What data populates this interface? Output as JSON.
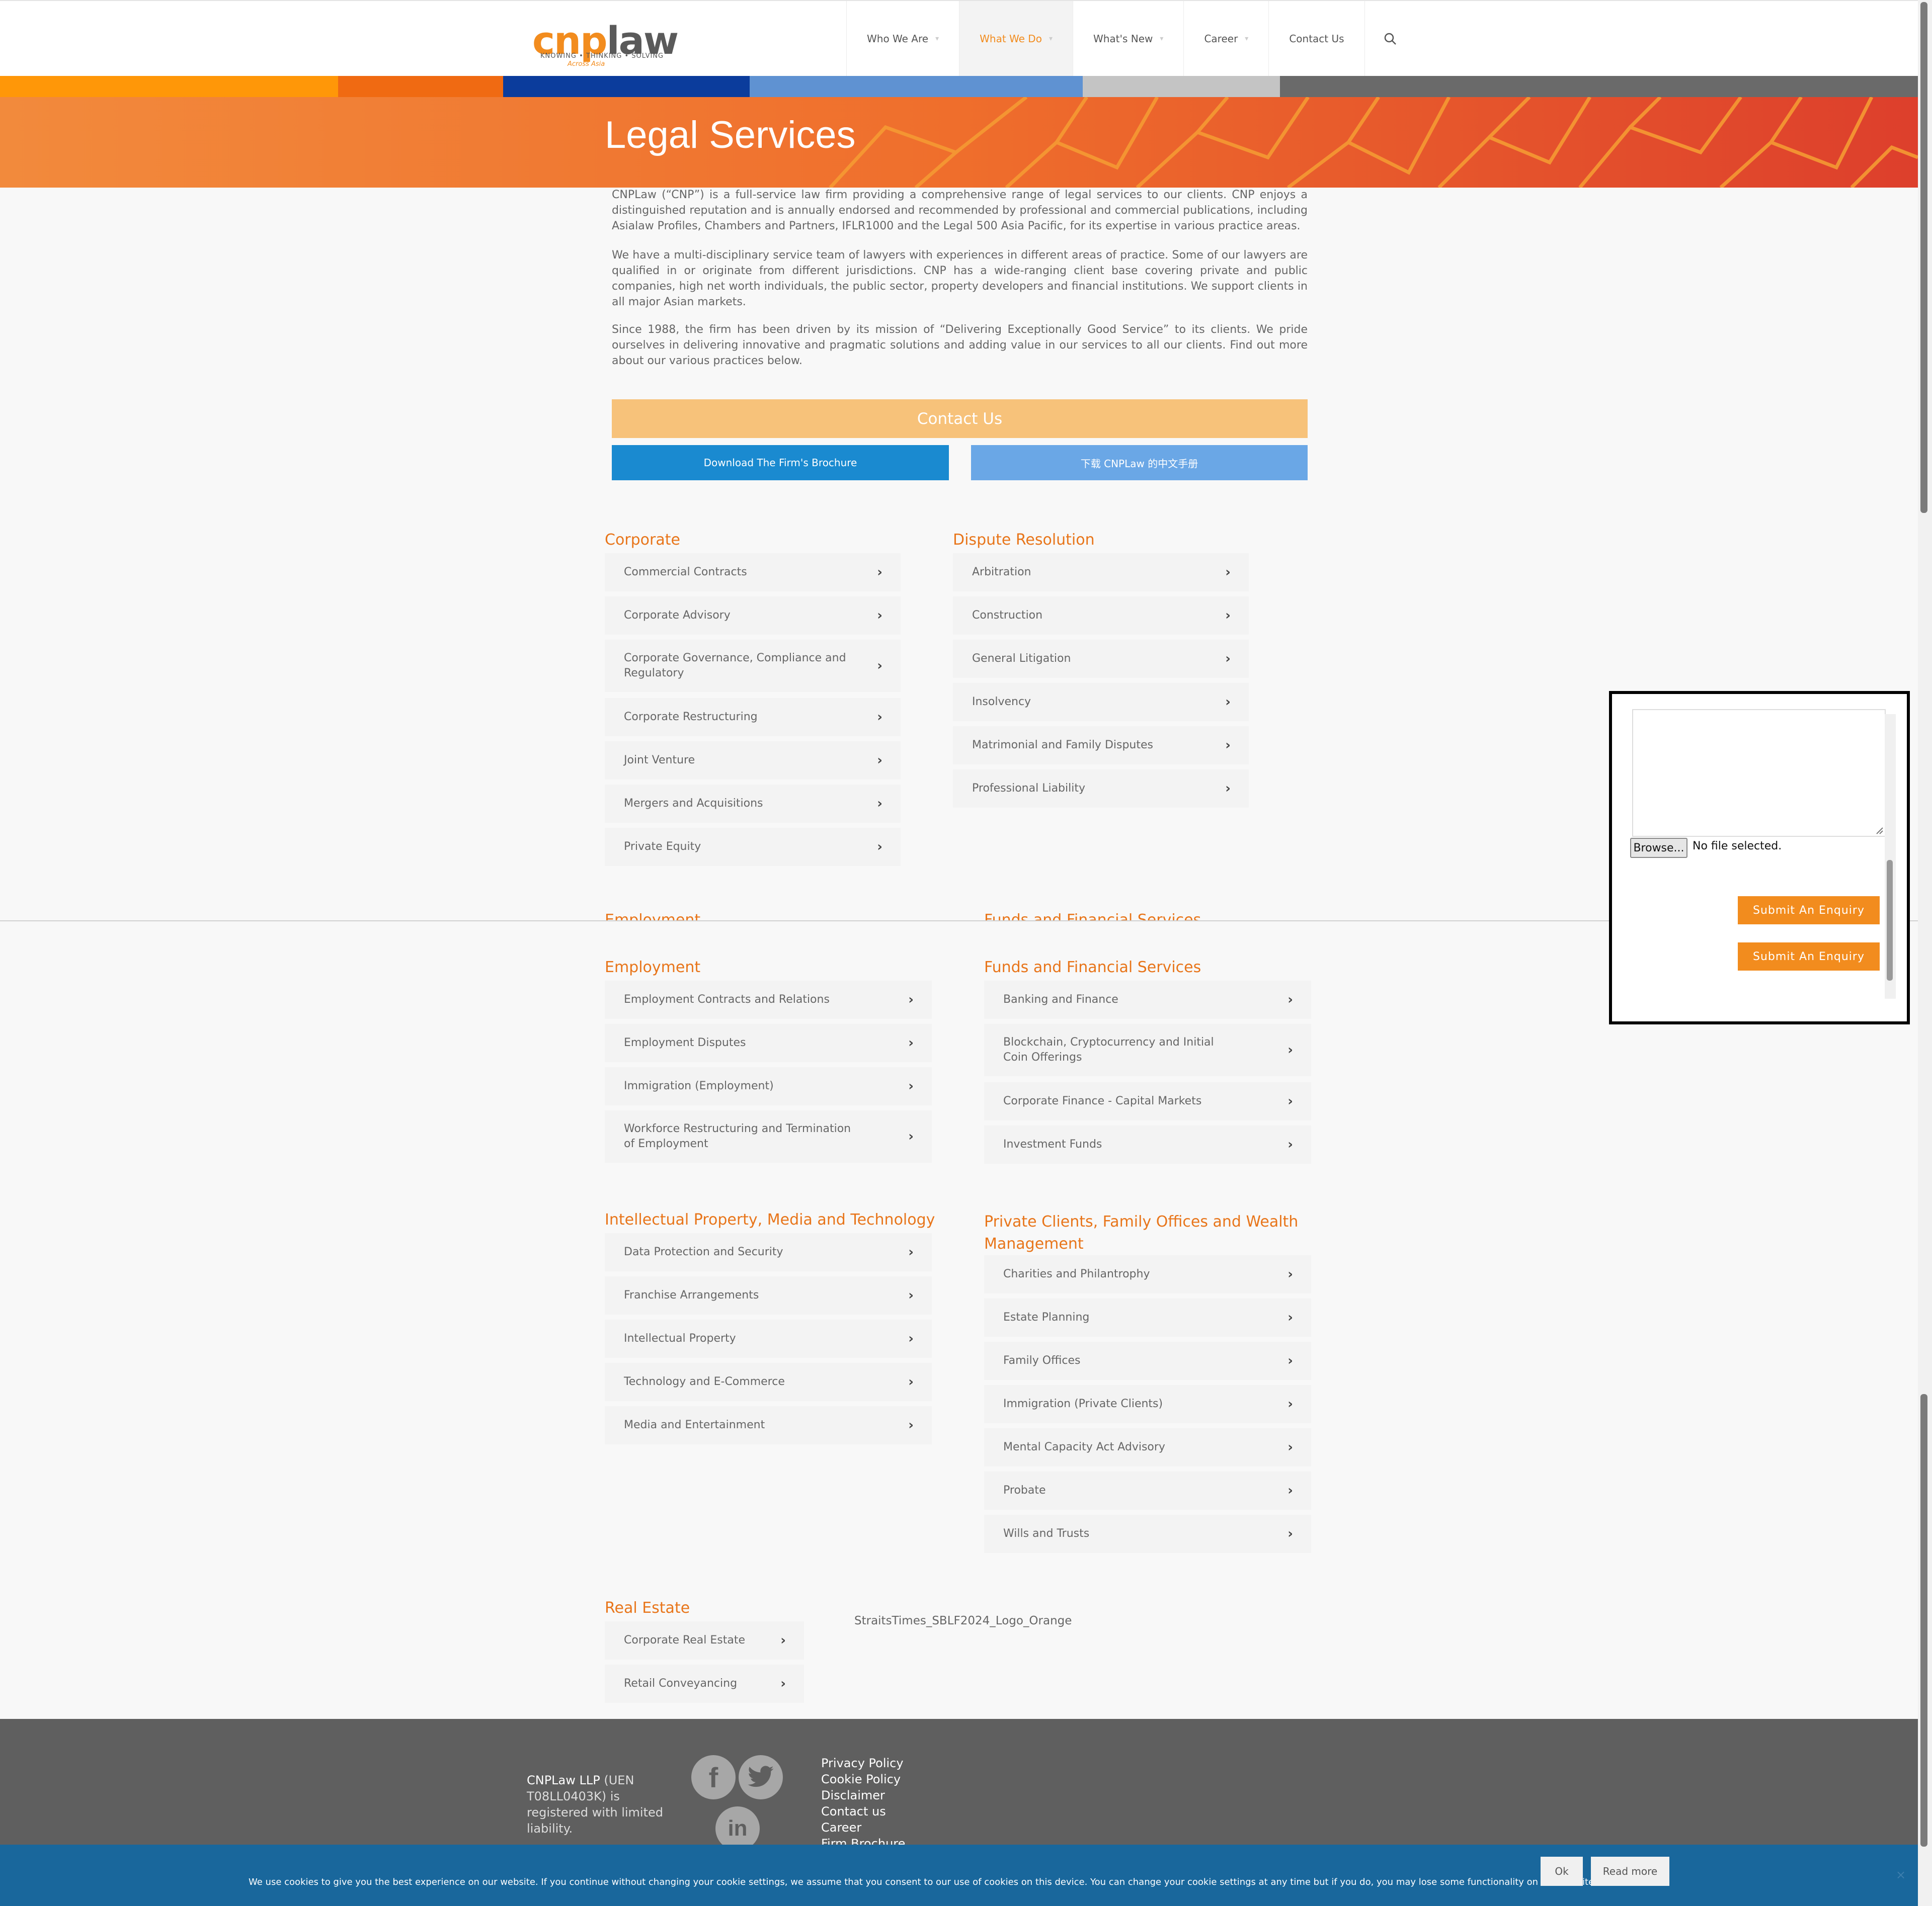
{
  "header": {
    "logo": {
      "word1": "cnp",
      "word2": "law",
      "tagline": "KNOWING • THINKING • SOLVING",
      "tagline2": "Across Asia"
    },
    "nav": [
      {
        "label": "Who We Are",
        "has_dropdown": true,
        "active": false
      },
      {
        "label": "What We Do",
        "has_dropdown": true,
        "active": true
      },
      {
        "label": "What's New",
        "has_dropdown": true,
        "active": false
      },
      {
        "label": "Career",
        "has_dropdown": true,
        "active": false
      },
      {
        "label": "Contact Us",
        "has_dropdown": false,
        "active": false
      }
    ],
    "search_icon": "search-icon"
  },
  "stripe_colors": [
    "#ff9708",
    "#f06a12",
    "#0b3c9c",
    "#5f92d2",
    "#c4c4c4",
    "#6a6a6a"
  ],
  "banner": {
    "title": "Legal Services"
  },
  "intro": [
    "CNPLaw (“CNP”) is a full-service law firm providing a comprehensive range of legal services to our clients.  CNP enjoys a distinguished reputation and is annually endorsed and recommended by professional and commercial publications, including Asialaw Profiles, Chambers and Partners, IFLR1000 and the Legal 500 Asia Pacific, for its expertise in various practice areas.",
    "We have a multi-disciplinary service team of lawyers with experiences in different areas of practice. Some of our lawyers are qualified in or originate from different jurisdictions.  CNP has a wide-ranging client base covering private and public companies, high net worth individuals, the public sector, property developers and financial institutions.  We support clients in all major Asian markets.",
    "Since 1988, the firm has been driven by its mission of “Delivering Exceptionally Good Service” to its clients.  We pride ourselves in delivering innovative and pragmatic solutions and adding value in our services to all our clients. Find out more about our various practices below."
  ],
  "buttons": {
    "contact": "Contact Us",
    "brochure": "Download The Firm's Brochure",
    "brochure_cn": "下载 CNPLaw 的中文手册"
  },
  "sections": {
    "corporate": {
      "title": "Corporate",
      "items": [
        "Commercial Contracts",
        "Corporate Advisory",
        "Corporate Governance, Compliance and Regulatory",
        "Corporate Restructuring",
        "Joint Venture",
        "Mergers and Acquisitions",
        "Private Equity"
      ]
    },
    "dispute": {
      "title": "Dispute Resolution",
      "items": [
        "Arbitration",
        "Construction",
        "General Litigation",
        "Insolvency",
        "Matrimonial and Family Disputes",
        "Professional Liability"
      ]
    },
    "employment": {
      "title": "Employment",
      "items": [
        "Employment Contracts and Relations",
        "Employment Disputes",
        "Immigration (Employment)",
        "Workforce Restructuring and Termination of Employment"
      ]
    },
    "funds": {
      "title": "Funds and Financial Services",
      "items": [
        "Banking and Finance",
        "Blockchain, Cryptocurrency and Initial Coin Offerings",
        "Corporate Finance - Capital Markets",
        "Investment Funds"
      ]
    },
    "ip": {
      "title": "Intellectual Property, Media and Technology",
      "items": [
        "Data Protection and Security",
        "Franchise Arrangements",
        "Intellectual Property",
        "Technology and E-Commerce",
        "Media and Entertainment"
      ]
    },
    "private": {
      "title": "Private Clients, Family Offices and Wealth Management",
      "items": [
        "Charities and Philantrophy",
        "Estate Planning",
        "Family Offices",
        "Immigration (Private Clients)",
        "Mental Capacity Act Advisory",
        "Probate",
        "Wills and Trusts"
      ]
    },
    "realestate": {
      "title": "Real Estate",
      "items": [
        "Corporate Real Estate",
        "Retail Conveyancing"
      ]
    }
  },
  "image_alt": "StraitsTimes_SBLF2024_Logo_Orange",
  "popup": {
    "browse_label": "Browse...",
    "file_status": "No file selected.",
    "submit_label": "Submit An Enquiry"
  },
  "footer": {
    "company": "CNPLaw LLP",
    "company_rest": " (UEN T08LL0403K) is registered with limited liability.",
    "social": [
      "facebook-icon",
      "twitter-icon",
      "linkedin-icon"
    ],
    "links": [
      "Privacy Policy",
      "Cookie Policy",
      "Disclaimer",
      "Contact us",
      "Career",
      "Firm Brochure"
    ]
  },
  "cookie": {
    "message": "We use cookies to give you the best experience on our website. If you continue without changing your cookie settings, we assume that you consent to our use of cookies on this device. You can change your cookie settings at any time but if you do, you may lose some functionality on our website.",
    "ok": "Ok",
    "read_more": "Read more",
    "close": "×"
  }
}
